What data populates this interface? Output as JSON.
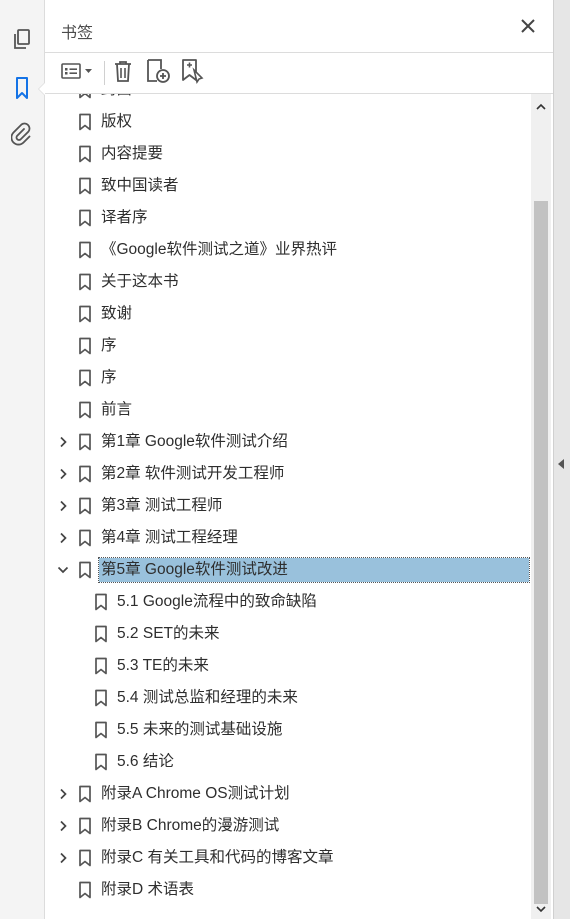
{
  "panel": {
    "title": "书签"
  },
  "rail": {
    "items": [
      {
        "icon": "pages-icon",
        "active": false
      },
      {
        "icon": "bookmark-icon",
        "active": true
      },
      {
        "icon": "attachment-icon",
        "active": false
      }
    ]
  },
  "toolbar": {
    "items": [
      "options-menu-icon",
      "delete-icon",
      "new-bookmark-icon",
      "bookmark-from-selection-icon"
    ]
  },
  "bookmarks": [
    {
      "label": "封面",
      "level": 0,
      "expandable": false,
      "expanded": false,
      "selected": false
    },
    {
      "label": "版权",
      "level": 0,
      "expandable": false,
      "expanded": false,
      "selected": false
    },
    {
      "label": "内容提要",
      "level": 0,
      "expandable": false,
      "expanded": false,
      "selected": false
    },
    {
      "label": "致中国读者",
      "level": 0,
      "expandable": false,
      "expanded": false,
      "selected": false
    },
    {
      "label": "译者序",
      "level": 0,
      "expandable": false,
      "expanded": false,
      "selected": false
    },
    {
      "label": "《Google软件测试之道》业界热评",
      "level": 0,
      "expandable": false,
      "expanded": false,
      "selected": false
    },
    {
      "label": "关于这本书",
      "level": 0,
      "expandable": false,
      "expanded": false,
      "selected": false
    },
    {
      "label": "致谢",
      "level": 0,
      "expandable": false,
      "expanded": false,
      "selected": false
    },
    {
      "label": "序",
      "level": 0,
      "expandable": false,
      "expanded": false,
      "selected": false
    },
    {
      "label": "序",
      "level": 0,
      "expandable": false,
      "expanded": false,
      "selected": false
    },
    {
      "label": "前言",
      "level": 0,
      "expandable": false,
      "expanded": false,
      "selected": false
    },
    {
      "label": "第1章 Google软件测试介绍",
      "level": 0,
      "expandable": true,
      "expanded": false,
      "selected": false
    },
    {
      "label": "第2章 软件测试开发工程师",
      "level": 0,
      "expandable": true,
      "expanded": false,
      "selected": false
    },
    {
      "label": "第3章 测试工程师",
      "level": 0,
      "expandable": true,
      "expanded": false,
      "selected": false
    },
    {
      "label": "第4章 测试工程经理",
      "level": 0,
      "expandable": true,
      "expanded": false,
      "selected": false
    },
    {
      "label": "第5章 Google软件测试改进",
      "level": 0,
      "expandable": true,
      "expanded": true,
      "selected": true
    },
    {
      "label": "5.1 Google流程中的致命缺陷",
      "level": 1,
      "expandable": false,
      "expanded": false,
      "selected": false
    },
    {
      "label": "5.2 SET的未来",
      "level": 1,
      "expandable": false,
      "expanded": false,
      "selected": false
    },
    {
      "label": "5.3 TE的未来",
      "level": 1,
      "expandable": false,
      "expanded": false,
      "selected": false
    },
    {
      "label": "5.4 测试总监和经理的未来",
      "level": 1,
      "expandable": false,
      "expanded": false,
      "selected": false
    },
    {
      "label": "5.5 未来的测试基础设施",
      "level": 1,
      "expandable": false,
      "expanded": false,
      "selected": false
    },
    {
      "label": "5.6 结论",
      "level": 1,
      "expandable": false,
      "expanded": false,
      "selected": false
    },
    {
      "label": "附录A Chrome OS测试计划",
      "level": 0,
      "expandable": true,
      "expanded": false,
      "selected": false
    },
    {
      "label": "附录B Chrome的漫游测试",
      "level": 0,
      "expandable": true,
      "expanded": false,
      "selected": false
    },
    {
      "label": "附录C 有关工具和代码的博客文章",
      "level": 0,
      "expandable": true,
      "expanded": false,
      "selected": false
    },
    {
      "label": "附录D 术语表",
      "level": 0,
      "expandable": false,
      "expanded": false,
      "selected": false
    }
  ],
  "colors": {
    "selection": "#99c1dc",
    "accent": "#1473e6",
    "icon": "#555555"
  }
}
